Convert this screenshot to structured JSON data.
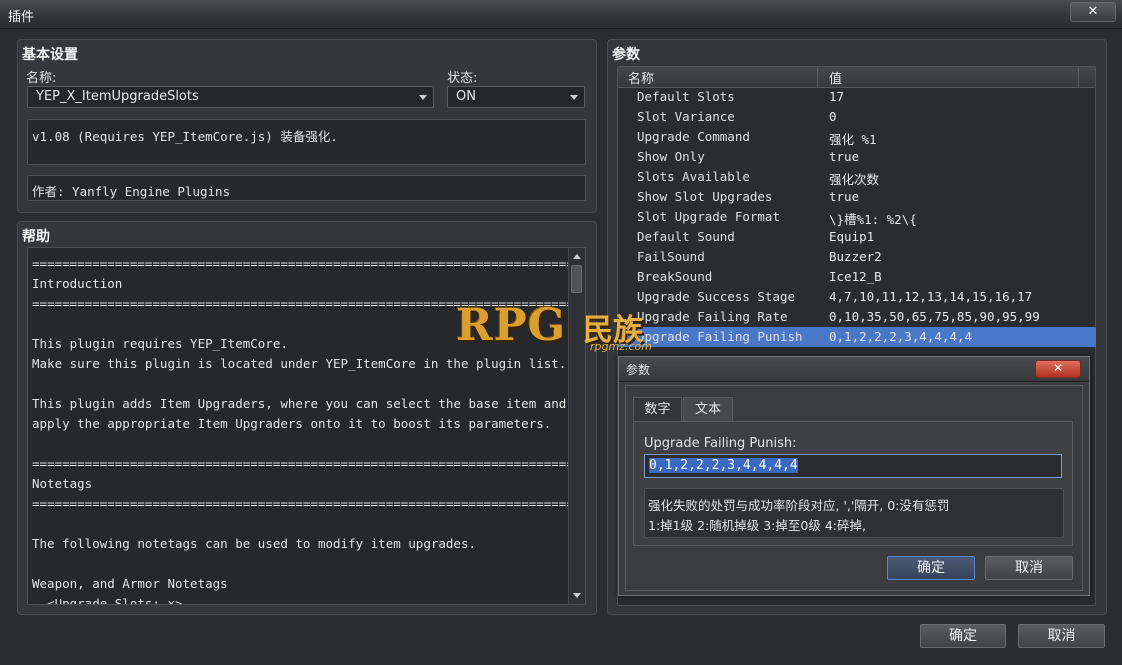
{
  "window": {
    "title": "插件",
    "close_glyph": "✕"
  },
  "basic": {
    "title": "基本设置",
    "name_label": "名称:",
    "name_value": "YEP_X_ItemUpgradeSlots",
    "status_label": "状态:",
    "status_value": "ON",
    "description": "v1.08 (Requires YEP_ItemCore.js) 装备强化.",
    "author": "作者: Yanfly Engine Plugins"
  },
  "help": {
    "title": "帮助",
    "lines": [
      "==========================================================================",
      "Introduction",
      "==========================================================================",
      "",
      "This plugin requires YEP_ItemCore.",
      "Make sure this plugin is located under YEP_ItemCore in the plugin list.",
      "",
      "This plugin adds Item Upgraders, where you can select the base item and then",
      "apply the appropriate Item Upgraders onto it to boost its parameters.",
      "",
      "==========================================================================",
      "Notetags",
      "==========================================================================",
      "",
      "The following notetags can be used to modify item upgrades.",
      "",
      "Weapon, and Armor Notetags",
      "  <Upgrade Slots: x>"
    ]
  },
  "params": {
    "title": "参数",
    "col_name": "名称",
    "col_value": "值",
    "rows": [
      {
        "name": "Default Slots",
        "value": "17"
      },
      {
        "name": "Slot Variance",
        "value": "0"
      },
      {
        "name": "Upgrade Command",
        "value": "强化 %1"
      },
      {
        "name": "Show Only",
        "value": "true"
      },
      {
        "name": "Slots Available",
        "value": "强化次数"
      },
      {
        "name": "Show Slot Upgrades",
        "value": "true"
      },
      {
        "name": "Slot Upgrade Format",
        "value": "\\}槽%1: %2\\{"
      },
      {
        "name": "Default Sound",
        "value": "Equip1"
      },
      {
        "name": "FailSound",
        "value": "Buzzer2"
      },
      {
        "name": "BreakSound",
        "value": "Ice12_B"
      },
      {
        "name": "Upgrade Success Stage",
        "value": "4,7,10,11,12,13,14,15,16,17"
      },
      {
        "name": "Upgrade Failing Rate",
        "value": "0,10,35,50,65,75,85,90,95,99"
      },
      {
        "name": "Upgrade Failing Punish",
        "value": "0,1,2,2,2,3,4,4,4,4"
      }
    ]
  },
  "dialog": {
    "title": "参数",
    "tab_number": "数字",
    "tab_text": "文本",
    "field_label": "Upgrade Failing Punish:",
    "field_value": "0,1,2,2,2,3,4,4,4,4",
    "note_line1": "强化失败的处罚与成功率阶段对应, ','隔开, 0:没有惩罚",
    "note_line2": "1:掉1级 2:随机掉级 3:掉至0级 4:碎掉,",
    "ok": "确定",
    "cancel": "取消"
  },
  "footer": {
    "ok": "确定",
    "cancel": "取消"
  },
  "watermark": {
    "text": "RPG",
    "text2": "民族",
    "url": "rpgmz.com"
  }
}
